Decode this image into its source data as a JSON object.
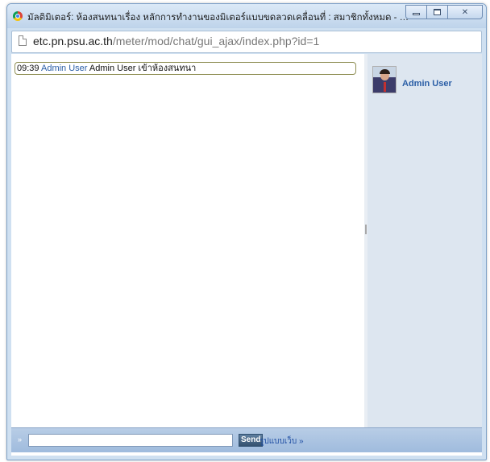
{
  "window": {
    "title": "มัลติมิเตอร์: ห้องสนทนาเรื่อง หลักการทำงานของมิเตอร์แบบขดลวดเคลื่อนที่ : สมาชิกทั้งหมด - Google C...",
    "url_host": "etc.pn.psu.ac.th",
    "url_path": "/meter/mod/chat/gui_ajax/index.php?id=1"
  },
  "chat": {
    "messages": [
      {
        "time": "09:39",
        "user": "Admin User",
        "text": "Admin User เข้าห้องสนทนา"
      }
    ]
  },
  "users": [
    {
      "name": "Admin User"
    }
  ],
  "input_bar": {
    "arrow": "»",
    "message_value": "",
    "send_label": "Send",
    "gui_link_label": "รูปแบบเว็บ »"
  },
  "icons": {
    "app": "chrome-icon",
    "page": "page-icon",
    "minimize": "minimize-icon",
    "maximize": "maximize-icon",
    "close": "close-icon"
  }
}
